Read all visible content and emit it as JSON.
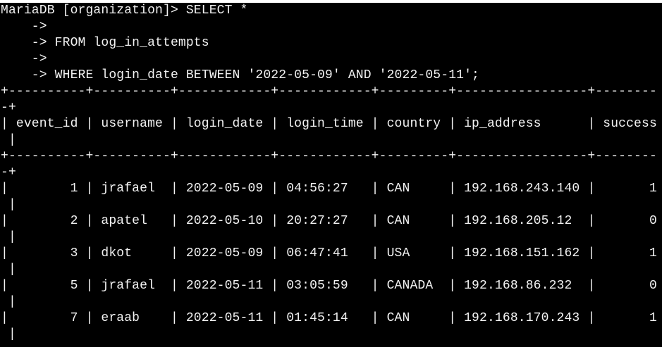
{
  "terminal": {
    "colors": {
      "background": "#000000",
      "text": "#f2f2f2"
    },
    "lines": [
      "MariaDB [organization]> SELECT *",
      "    ->",
      "    -> FROM log_in_attempts",
      "    ->",
      "    -> WHERE login_date BETWEEN '2022-05-09' AND '2022-05-11';",
      "+----------+----------+------------+------------+---------+-----------------+--------",
      "-+",
      "| event_id | username | login_date | login_time | country | ip_address      | success",
      " |",
      "+----------+----------+------------+------------+---------+-----------------+--------",
      "-+",
      "|        1 | jrafael  | 2022-05-09 | 04:56:27   | CAN     | 192.168.243.140 |       1",
      " |",
      "|        2 | apatel   | 2022-05-10 | 20:27:27   | CAN     | 192.168.205.12  |       0",
      " |",
      "|        3 | dkot     | 2022-05-09 | 06:47:41   | USA     | 192.168.151.162 |       1",
      " |",
      "|        5 | jrafael  | 2022-05-11 | 03:05:59   | CANADA  | 192.168.86.232  |       0",
      " |",
      "|        7 | eraab    | 2022-05-11 | 01:45:14   | CAN     | 192.168.170.243 |       1",
      " |"
    ]
  }
}
